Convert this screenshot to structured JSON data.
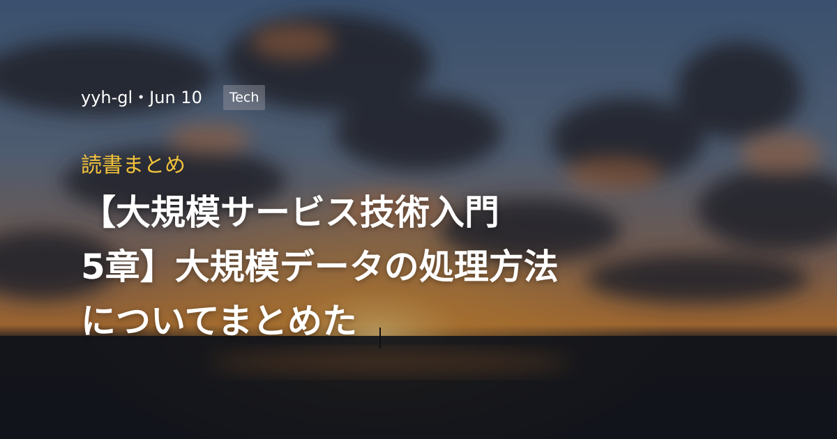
{
  "card": {
    "byline": "yyh-gl・Jun 10",
    "tag": "Tech",
    "category": "読書まとめ",
    "title_lines": [
      "【大規模サービス技術入門",
      "5章】大規模データの処理方法",
      "についてまとめた"
    ]
  },
  "colors": {
    "category": "#f2c23c",
    "title": "#ffffff",
    "tag_bg": "#96969f",
    "sky_top": "#4f6e94",
    "sun_glow": "#f2a23a",
    "sea": "#16181d"
  }
}
